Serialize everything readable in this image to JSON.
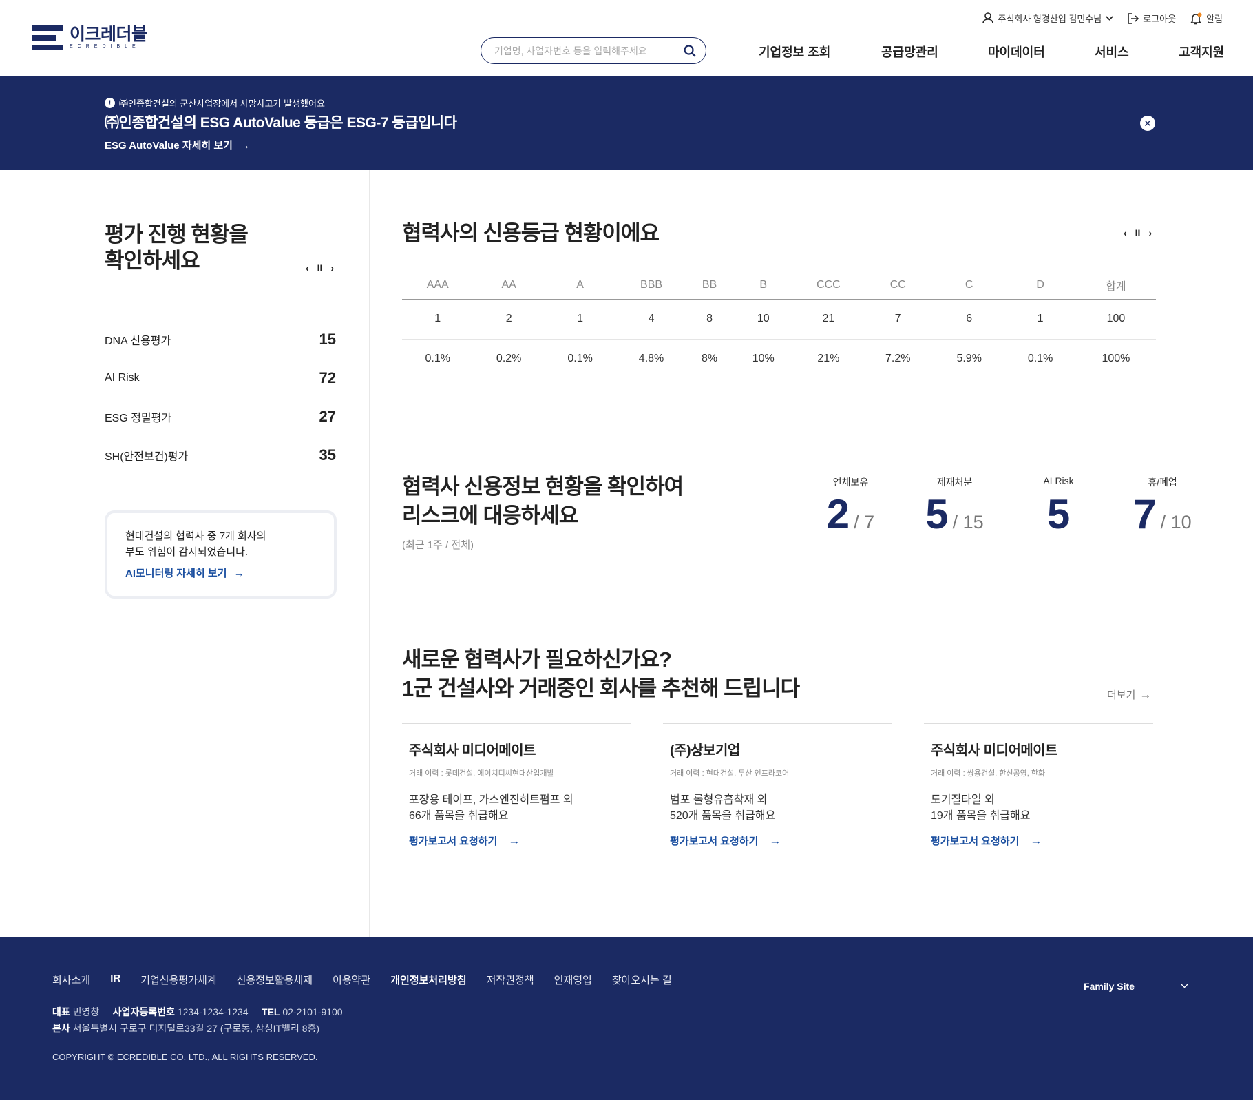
{
  "header": {
    "logo_text": "이크레더블",
    "logo_sub": "ECREDIBLE",
    "user_label": "주식회사 형경산업 김민수님",
    "logout_label": "로그아웃",
    "alarm_label": "알림",
    "search_placeholder": "기업명, 사업자번호 등을 입력해주세요",
    "nav": [
      "기업정보 조회",
      "공급망관리",
      "마이데이터",
      "서비스",
      "고객지원"
    ]
  },
  "banner": {
    "notice": "㈜인종합건설의 군산사업장에서 사망사고가 발생했어요",
    "headline": "㈜인종합건설의 ESG AutoValue 등급은 ESG-7 등급입니다",
    "more": "ESG AutoValue 자세히 보기"
  },
  "left": {
    "title_line1": "평가 진행 현황을",
    "title_line2": "확인하세요",
    "items": [
      {
        "label": "DNA 신용평가",
        "value": "15"
      },
      {
        "label": "AI Risk",
        "value": "72"
      },
      {
        "label": "ESG 정밀평가",
        "value": "27"
      },
      {
        "label": "SH(안전보건)평가",
        "value": "35"
      }
    ],
    "alert_line1": "현대건설의 협력사 중 7개 회사의",
    "alert_line2": "부도 위험이 감지되었습니다.",
    "alert_link": "AI모니터링 자세히 보기"
  },
  "grades": {
    "title": "협력사의 신용등급 현황이에요",
    "headers": [
      "AAA",
      "AA",
      "A",
      "BBB",
      "BB",
      "B",
      "CCC",
      "CC",
      "C",
      "D",
      "합계"
    ],
    "counts": [
      "1",
      "2",
      "1",
      "4",
      "8",
      "10",
      "21",
      "7",
      "6",
      "1",
      "100"
    ],
    "ratios": [
      "0.1%",
      "0.2%",
      "0.1%",
      "4.8%",
      "8%",
      "10%",
      "21%",
      "7.2%",
      "5.9%",
      "0.1%",
      "100%"
    ]
  },
  "credit_info": {
    "title_line1": "협력사 신용정보 현황을 확인하여",
    "title_line2": "리스크에 대응하세요",
    "sub": "(최근 1주 / 전체)",
    "stats": [
      {
        "label": "연체보유",
        "value": "2",
        "total": "/ 7"
      },
      {
        "label": "제재처분",
        "value": "5",
        "total": "/ 15"
      },
      {
        "label": "AI Risk",
        "value": "5",
        "total": ""
      },
      {
        "label": "휴/폐업",
        "value": "7",
        "total": "/ 10"
      }
    ]
  },
  "recommend": {
    "title_line1": "새로운 협력사가 필요하신가요?",
    "title_line2": "1군 건설사와 거래중인 회사를 추천해 드립니다",
    "more": "더보기",
    "cards": [
      {
        "name": "주식회사 미디어메이트",
        "history": "거래 이력 : 롯데건설, 에이치디씨현대산업개발",
        "desc1": "포장용 테이프, 가스엔진히트펌프 외",
        "desc2": "66개 품목을 취급해요",
        "link": "평가보고서 요청하기"
      },
      {
        "name": "(주)상보기업",
        "history": "거래 이력 : 현대건설, 두산 인프라코어",
        "desc1": "범포 롤형유흡착재 외",
        "desc2": "520개 품목을 취급해요",
        "link": "평가보고서 요청하기"
      },
      {
        "name": "주식회사 미디어메이트",
        "history": "거래 이력 : 쌍용건설, 한신공영, 한화",
        "desc1": "도기질타일 외",
        "desc2": "19개 품목을 취급해요",
        "link": "평가보고서 요청하기"
      }
    ]
  },
  "footer": {
    "nav": [
      "회사소개",
      "IR",
      "기업신용평가체계",
      "신용정보활용체제",
      "이용약관",
      "개인정보처리방침",
      "저작권정책",
      "인재영입",
      "찾아오시는 길"
    ],
    "ceo_label": "대표",
    "ceo": "민영창",
    "bizno_label": "사업자등록번호",
    "bizno": "1234-1234-1234",
    "tel_label": "TEL",
    "tel": "02-2101-9100",
    "addr_label": "본사",
    "addr": "서울특별시 구로구 디지털로33길 27 (구로동, 삼성IT밸리 8층)",
    "copyright": "COPYRIGHT © ECREDIBLE CO. LTD., ALL RIGHTS RESERVED.",
    "family_site": "Family Site"
  },
  "colors": {
    "brand": "#1b2a63",
    "link": "#1b4fa0",
    "alarm_dot": "#f08a24"
  }
}
